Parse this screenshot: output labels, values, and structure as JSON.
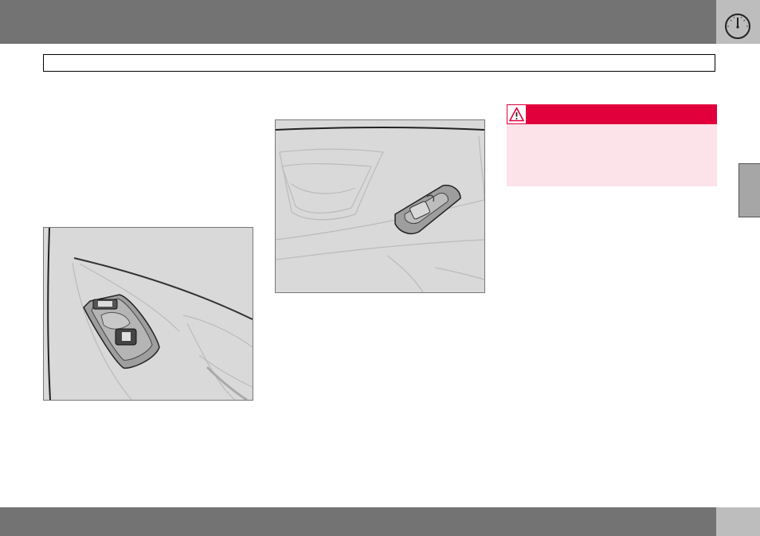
{
  "header": {
    "icon": "gauge-icon",
    "bar_color": "#737373",
    "icon_box_color": "#bdbdbd"
  },
  "section_title": {
    "text": ""
  },
  "figures": [
    {
      "name": "door-panel-window-switch-front",
      "icon": "window-switch-illustration"
    },
    {
      "name": "door-panel-window-switch-rear",
      "icon": "window-switch-illustration"
    }
  ],
  "warning": {
    "icon": "warning-triangle-icon",
    "header_color": "#e1003c",
    "body_color": "#fbe3e9",
    "text": ""
  },
  "side_tab": {
    "color": "#a6a6a6"
  },
  "footer": {
    "page_number": ""
  }
}
